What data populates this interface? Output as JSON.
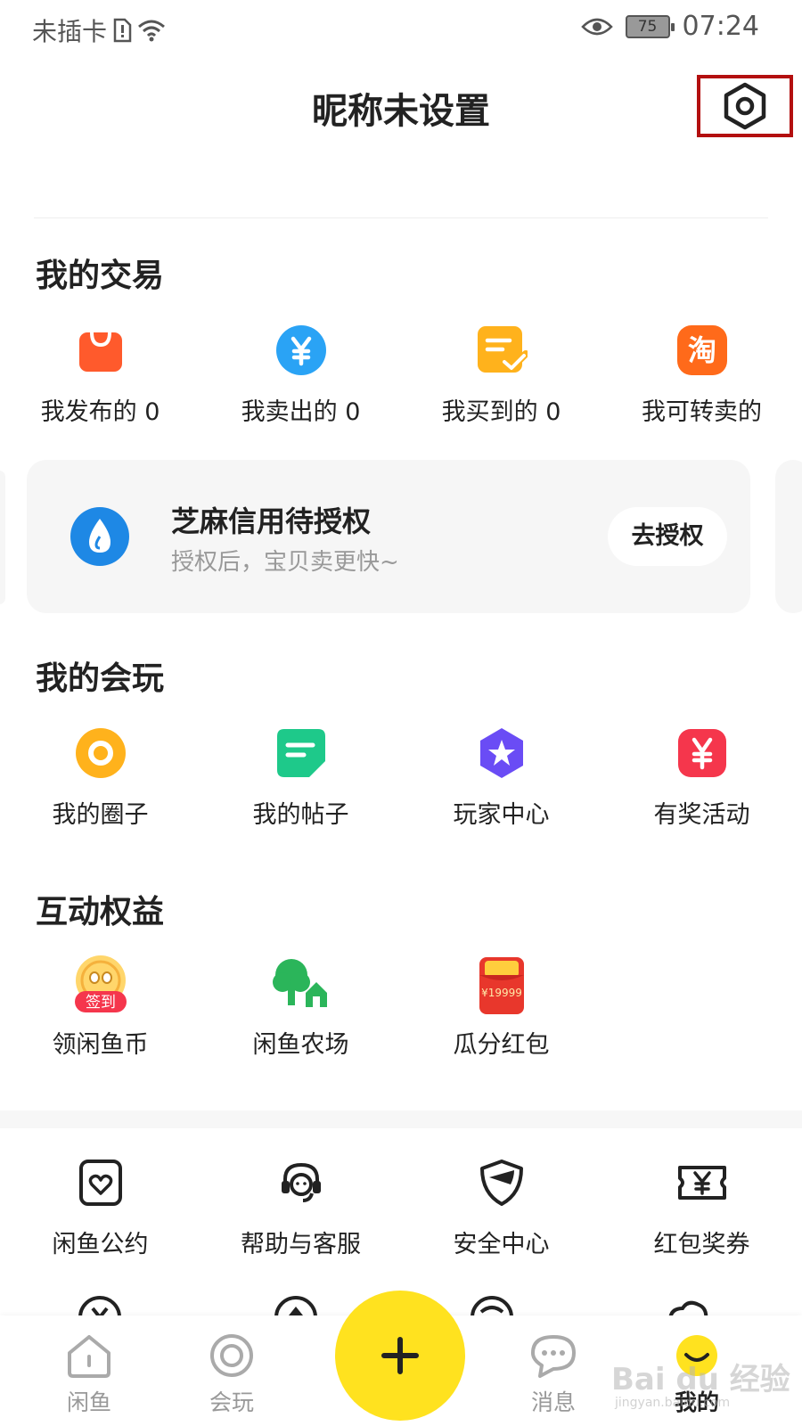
{
  "status_bar": {
    "carrier": "未插卡",
    "battery": "75",
    "time": "07:24"
  },
  "header": {
    "title": "昵称未设置"
  },
  "trade": {
    "title": "我的交易",
    "items": [
      {
        "label": "我发布的 0",
        "icon": "shopping-bag-icon",
        "color": "#ff5a2c"
      },
      {
        "label": "我卖出的 0",
        "icon": "yuan-coin-icon",
        "color": "#2aa3f5"
      },
      {
        "label": "我买到的 0",
        "icon": "order-check-icon",
        "color": "#ffb21c"
      },
      {
        "label": "我可转卖的",
        "icon": "taobao-icon",
        "color": "#ff6a1a"
      }
    ]
  },
  "credit": {
    "title": "芝麻信用待授权",
    "subtitle": "授权后，宝贝卖更快~",
    "button": "去授权",
    "color": "#1e88e5"
  },
  "play": {
    "title": "我的会玩",
    "items": [
      {
        "label": "我的圈子",
        "icon": "circle-ring-icon",
        "color": "#ffb21c"
      },
      {
        "label": "我的帖子",
        "icon": "post-icon",
        "color": "#1ec98a"
      },
      {
        "label": "玩家中心",
        "icon": "star-badge-icon",
        "color": "#6a4cf5"
      },
      {
        "label": "有奖活动",
        "icon": "prize-yuan-icon",
        "color": "#f5364c"
      }
    ]
  },
  "benefits": {
    "title": "互动权益",
    "items": [
      {
        "label": "领闲鱼币",
        "icon": "checkin-icon",
        "badge": "签到"
      },
      {
        "label": "闲鱼农场",
        "icon": "farm-icon"
      },
      {
        "label": "瓜分红包",
        "icon": "red-envelope-icon",
        "badge": "¥19999"
      }
    ]
  },
  "services": {
    "items": [
      {
        "label": "闲鱼公约",
        "icon": "heart-doc-icon"
      },
      {
        "label": "帮助与客服",
        "icon": "headset-icon"
      },
      {
        "label": "安全中心",
        "icon": "shield-icon"
      },
      {
        "label": "红包奖券",
        "icon": "coupon-icon"
      }
    ]
  },
  "nav": {
    "items": [
      {
        "label": "闲鱼",
        "icon": "home-icon"
      },
      {
        "label": "会玩",
        "icon": "play-circle-icon"
      },
      {
        "label": "消息",
        "icon": "message-icon"
      },
      {
        "label": "我的",
        "icon": "profile-icon"
      }
    ],
    "publish_icon": "plus-icon"
  },
  "watermark": {
    "main": "Bai du 经验",
    "sub": "jingyan.baidu.com"
  }
}
